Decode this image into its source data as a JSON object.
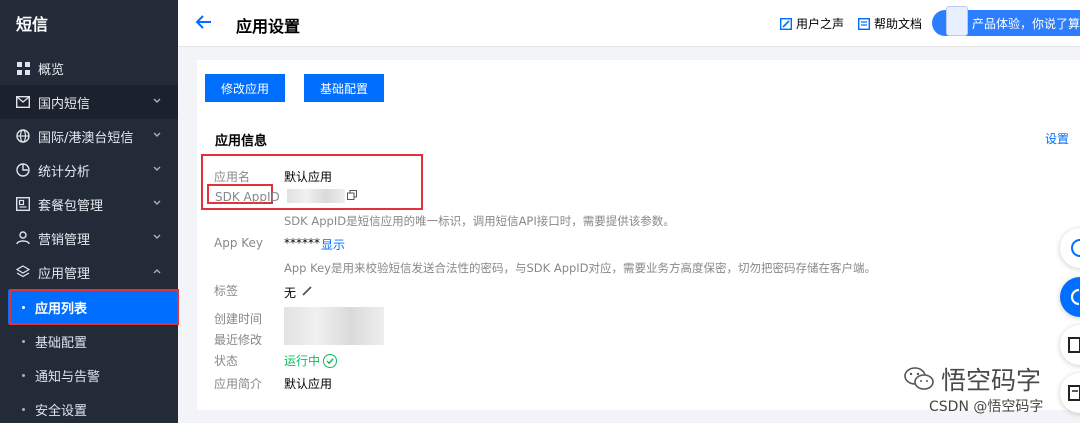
{
  "sidebar": {
    "brand": "短信",
    "items": [
      {
        "label": "概览",
        "icon": "grid-icon"
      },
      {
        "label": "国内短信",
        "icon": "mail-icon"
      },
      {
        "label": "国际/港澳台短信",
        "icon": "globe-icon"
      },
      {
        "label": "统计分析",
        "icon": "pie-icon"
      },
      {
        "label": "套餐包管理",
        "icon": "package-icon"
      },
      {
        "label": "营销管理",
        "icon": "user-icon"
      },
      {
        "label": "应用管理",
        "icon": "layers-icon"
      }
    ],
    "sub_items": [
      {
        "label": "应用列表"
      },
      {
        "label": "基础配置"
      },
      {
        "label": "通知与告警"
      },
      {
        "label": "安全设置"
      }
    ]
  },
  "header": {
    "title": "应用设置",
    "voice_label": "用户之声",
    "docs_label": "帮助文档",
    "promo_label": "产品体验，你说了算"
  },
  "toolbar": {
    "edit_label": "修改应用",
    "config_label": "基础配置"
  },
  "info": {
    "section_title": "应用信息",
    "settings_label": "设置",
    "app_name_label": "应用名",
    "app_name_value": "默认应用",
    "sdk_label": "SDK AppID",
    "sdk_hint": "SDK AppID是短信应用的唯一标识，调用短信API接口时，需要提供该参数。",
    "key_label": "App Key",
    "key_value": "******",
    "key_show": "显示",
    "key_hint": "App Key是用来校验短信发送合法性的密码，与SDK AppID对应，需要业务方高度保密，切勿把密码存储在客户端。",
    "tag_label": "标签",
    "tag_value": "无",
    "created_label": "创建时间",
    "modified_label": "最近修改",
    "status_label": "状态",
    "status_value": "运行中",
    "desc_label": "应用简介",
    "desc_value": "默认应用"
  },
  "watermark": {
    "brand": "悟空码字",
    "csdn": "CSDN @悟空码字"
  },
  "colors": {
    "accent": "#006eff",
    "sidebar_bg": "#232a38",
    "success": "#0abf5b",
    "highlight": "#e0323b"
  }
}
